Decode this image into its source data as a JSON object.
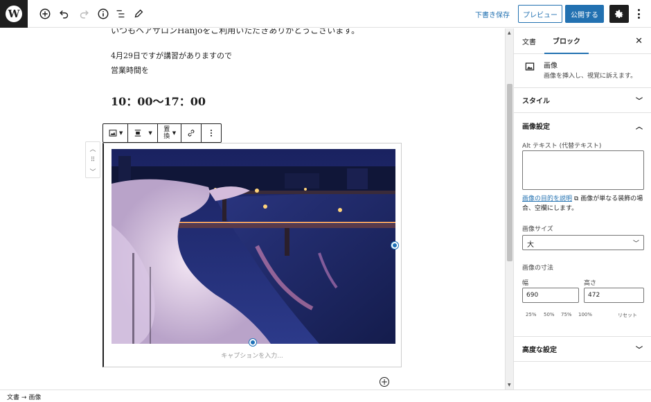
{
  "topbar": {
    "logo": "W",
    "icons": [
      "add-block-icon",
      "undo-icon",
      "redo-icon",
      "info-icon",
      "list-view-icon",
      "edit-tools-icon"
    ],
    "save_draft": "下書き保存",
    "preview": "プレビュー",
    "publish": "公開する"
  },
  "content": {
    "cut_line": "いつもヘアサロンHanjoをご利用いただきありがとうございます。",
    "line1": "4月29日ですが講習がありますので",
    "line2": "営業時間を",
    "hours": "10：00〜17：00",
    "caption_placeholder": "キャプションを入力..."
  },
  "block_toolbar": {
    "replace": "置換"
  },
  "sidebar": {
    "tabs": [
      "文書",
      "ブロック"
    ],
    "active_tab": "ブロック",
    "block_title": "画像",
    "block_desc": "画像を挿入し、視覚に訴えます。",
    "style_panel": "スタイル",
    "settings_panel": "画像設定",
    "alt_label": "Alt テキスト (代替テキスト)",
    "alt_link": "画像の目的を説明",
    "alt_help": "画像が単なる装飾の場合、空欄にします。",
    "size_label": "画像サイズ",
    "size_value": "大",
    "dims_label": "画像の寸法",
    "width_label": "幅",
    "height_label": "高さ",
    "width_value": "690",
    "height_value": "472",
    "pcts": [
      "25%",
      "50%",
      "75%",
      "100%"
    ],
    "reset": "リセット",
    "advanced_panel": "高度な設定"
  },
  "breadcrumb": {
    "root": "文書",
    "arrow": "→",
    "current": "画像"
  },
  "colors": {
    "accent": "#2271b1",
    "dark": "#1e1e1e"
  }
}
